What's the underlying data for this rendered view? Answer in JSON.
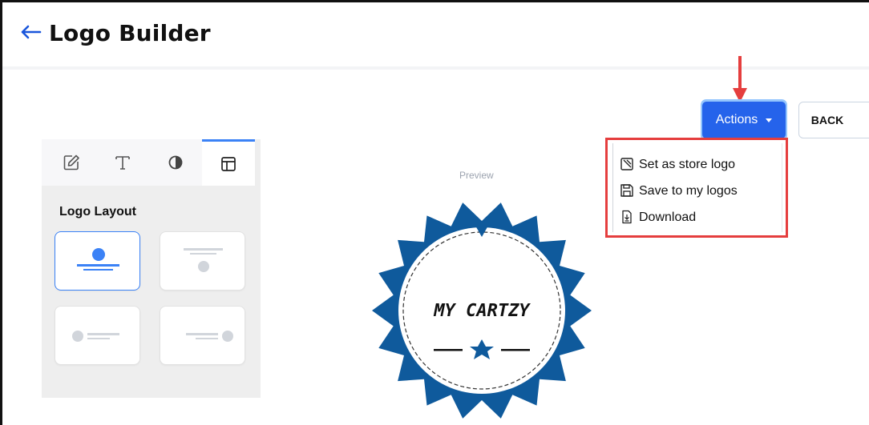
{
  "header": {
    "title": "Logo Builder"
  },
  "tabs": [
    {
      "name": "edit",
      "icon": "edit-icon"
    },
    {
      "name": "text",
      "icon": "text-icon"
    },
    {
      "name": "contrast",
      "icon": "contrast-icon"
    },
    {
      "name": "layout",
      "icon": "layout-icon",
      "active": true
    }
  ],
  "panel": {
    "title": "Logo Layout"
  },
  "preview": {
    "label": "Preview",
    "logo_text": "MY CARTZY"
  },
  "actions": {
    "button_label": "Actions",
    "back_label": "BACK",
    "menu": [
      {
        "label": "Set as store logo",
        "icon": "store-logo-icon"
      },
      {
        "label": "Save to my logos",
        "icon": "save-icon"
      },
      {
        "label": "Download",
        "icon": "download-icon"
      }
    ]
  },
  "colors": {
    "accent": "#2563eb",
    "badge": "#0f5a9c",
    "highlight": "#e53e3e"
  }
}
